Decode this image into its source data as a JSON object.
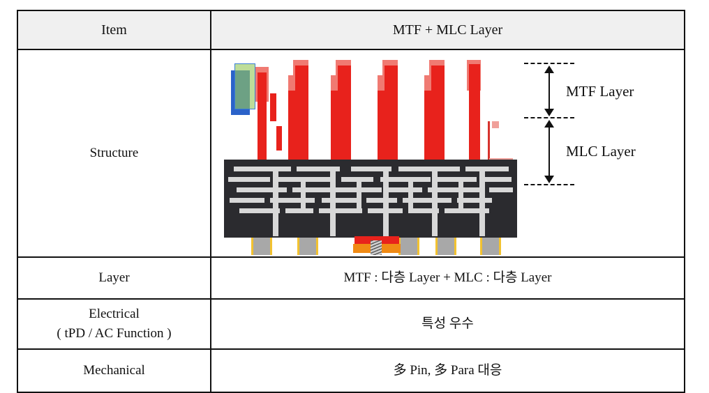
{
  "table": {
    "header": {
      "item_label": "Item",
      "value_label": "MTF + MLC Layer"
    },
    "rows": [
      {
        "item": "Structure",
        "kind": "diagram"
      },
      {
        "item": "Layer",
        "value": "MTF : 다층 Layer + MLC : 다층 Layer"
      },
      {
        "item_line1": "Electrical",
        "item_line2": "( tPD / AC Function )",
        "value": "특성 우수"
      },
      {
        "item": "Mechanical",
        "value": "多 Pin, 多 Para 대응"
      }
    ]
  },
  "diagram": {
    "annotations": {
      "mtf_layer_label": "MTF Layer",
      "mlc_layer_label": "MLC Layer"
    },
    "colors": {
      "pillar_red": "#e8221c",
      "pillar_light_red": "#f07a72",
      "substrate_dark": "#2b2b2f",
      "trace_gray": "#d8d8d8",
      "pin_gray": "#a8a8a8",
      "pin_outline_gold": "#f2c230",
      "highlight_blue": "#2b62c9",
      "highlight_green": "#96c85a",
      "pogo_orange": "#f08a14"
    },
    "parts": {
      "substrate_name": "MLC substrate",
      "pillar_name": "MTF pillar",
      "pin_name": "contact pin",
      "pogo_name": "spring pogo pin",
      "highlight_name": "highlighted component"
    }
  },
  "table_style": {
    "header_background": "#f0f0f0",
    "border_color": "#111111",
    "page_background": "#ffffff"
  }
}
